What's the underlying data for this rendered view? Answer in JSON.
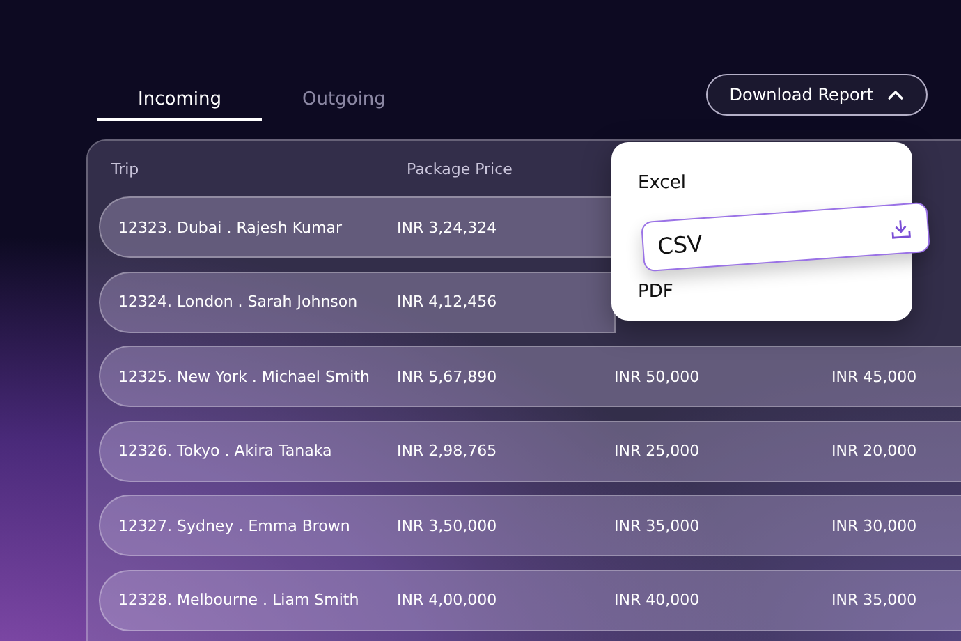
{
  "tabs": [
    {
      "label": "Incoming",
      "selected": true
    },
    {
      "label": "Outgoing",
      "selected": false
    }
  ],
  "download_button": {
    "label": "Download Report",
    "expanded": true
  },
  "dropdown": {
    "items": [
      {
        "label": "Excel",
        "selected": false
      },
      {
        "label": "CSV",
        "selected": true
      },
      {
        "label": "PDF",
        "selected": false
      }
    ]
  },
  "table": {
    "columns": [
      "Trip",
      "Package Price"
    ],
    "rows": [
      {
        "cells": [
          "12323. Dubai . Rajesh Kumar",
          "INR 3,24,324"
        ]
      },
      {
        "cells": [
          "12324. London . Sarah Johnson",
          "INR 4,12,456"
        ]
      },
      {
        "cells": [
          "12325. New York . Michael Smith",
          "INR 5,67,890",
          "INR 50,000",
          "INR 45,000"
        ]
      },
      {
        "cells": [
          "12326. Tokyo . Akira Tanaka",
          "INR 2,98,765",
          "INR 25,000",
          "INR 20,000"
        ]
      },
      {
        "cells": [
          "12327. Sydney . Emma Brown",
          "INR 3,50,000",
          "INR 35,000",
          "INR 30,000"
        ]
      },
      {
        "cells": [
          "12328. Melbourne . Liam Smith",
          "INR 4,00,000",
          "INR 40,000",
          "INR 35,000"
        ]
      }
    ]
  }
}
